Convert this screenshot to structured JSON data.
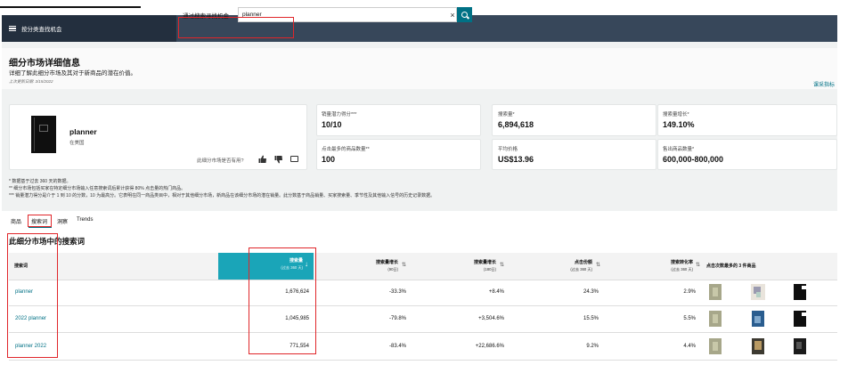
{
  "header": {
    "nav_label": "按分类查找机会",
    "search_prefix": "通过搜索寻找机会",
    "search_value": "planner",
    "clear_glyph": "×"
  },
  "title": {
    "heading": "细分市场详细信息",
    "subtitle": "详细了解此细分市场及其对于新商品的潜在价值。",
    "updated": "上次更新日期: 3/15/2022",
    "learn_link": "课采指标"
  },
  "product": {
    "name": "planner",
    "country": "在美国",
    "helpful_question": "此细分市场是否有用?"
  },
  "metrics": [
    {
      "label": "销量潜力得分***",
      "value": "10/10"
    },
    {
      "label": "搜索量*",
      "value": "6,894,618"
    },
    {
      "label": "搜索量增长*",
      "value": "149.10%"
    },
    {
      "label": "点击最多的商品数量**",
      "value": "100"
    },
    {
      "label": "平均价格",
      "value": "US$13.96"
    },
    {
      "label": "售出商品数量*",
      "value": "600,000-800,000"
    }
  ],
  "footnotes": [
    "* 数据基于过去 360 天的数据。",
    "** 细分市场包括买家在特定细分市场输入任意搜索词后累计获得 80% 点击量的热门商品。",
    "*** 销量潜力得分是介于 1 到 10 的分数，10 为最高分。它表明在同一商品类目中，相对于其他细分市场，新商品在该细分市场的潜在销量。此分数基于商品销量、买家搜索量、季节性及其他输入信号的历史记录数据。"
  ],
  "tabs": [
    "商品",
    "搜索词",
    "洞察",
    "Trends"
  ],
  "section_title": "此细分市场中的搜索词",
  "table": {
    "headers": {
      "keyword": "搜索词",
      "volume": "搜索量",
      "volume_sub": "(过去 360 天)",
      "growth_90": "搜索量增长",
      "growth_90_sub": "(90日)",
      "growth_180": "搜索量增长",
      "growth_180_sub": "(180日)",
      "click_share": "点击份额",
      "click_share_sub": "(过去 360 天)",
      "conversion": "搜索转化率",
      "conversion_sub": "(过去 360 天)",
      "top3": "点击次数最多的 3 件商品"
    },
    "rows": [
      {
        "keyword": "planner",
        "volume": "1,676,624",
        "growth_90": "-33.3%",
        "growth_180": "+8.4%",
        "click_share": "24.3%",
        "conversion": "2.9%"
      },
      {
        "keyword": "2022 planner",
        "volume": "1,045,985",
        "growth_90": "-79.8%",
        "growth_180": "+3,504.6%",
        "click_share": "15.5%",
        "conversion": "5.5%"
      },
      {
        "keyword": "planner 2022",
        "volume": "771,554",
        "growth_90": "-83.4%",
        "growth_180": "+22,686.6%",
        "click_share": "9.2%",
        "conversion": "4.4%"
      }
    ]
  },
  "colors": {
    "header_bg": "#232f3e",
    "search_bg": "#37475a",
    "accent_teal": "#007185",
    "highlight_red": "#e0262a",
    "volume_column": "#1aa5b8"
  }
}
